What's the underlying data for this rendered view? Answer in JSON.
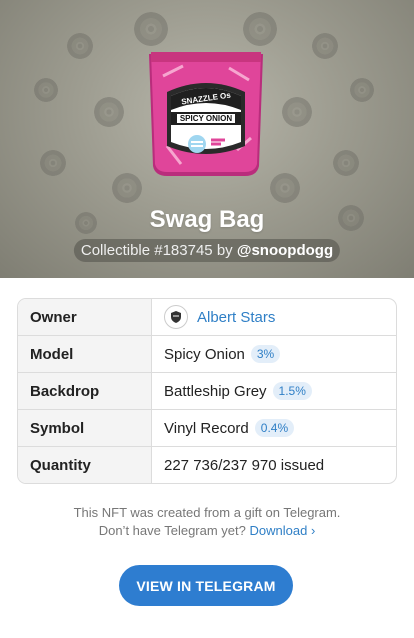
{
  "hero": {
    "title": "Swag Bag",
    "subtitle_prefix": "Collectible #183745 by ",
    "author": "@snoopdogg",
    "item_text_top": "SNAZZLE Os",
    "item_text_label": "SPICY ONION",
    "colors": {
      "backdrop": "#9d9c90",
      "bag": "#e0459a"
    }
  },
  "attributes": [
    {
      "key": "Owner",
      "value": "Albert Stars",
      "badge": null,
      "link": true
    },
    {
      "key": "Model",
      "value": "Spicy Onion",
      "badge": "3%"
    },
    {
      "key": "Backdrop",
      "value": "Battleship Grey",
      "badge": "1.5%"
    },
    {
      "key": "Symbol",
      "value": "Vinyl Record",
      "badge": "0.4%"
    },
    {
      "key": "Quantity",
      "value": "227 736/237 970 issued",
      "badge": null
    }
  ],
  "footer": {
    "line1": "This NFT was created from a gift on Telegram.",
    "line2": "Don’t have Telegram yet?",
    "download": "Download ›"
  },
  "cta": {
    "label": "VIEW IN TELEGRAM",
    "color": "#2e7dd0"
  }
}
